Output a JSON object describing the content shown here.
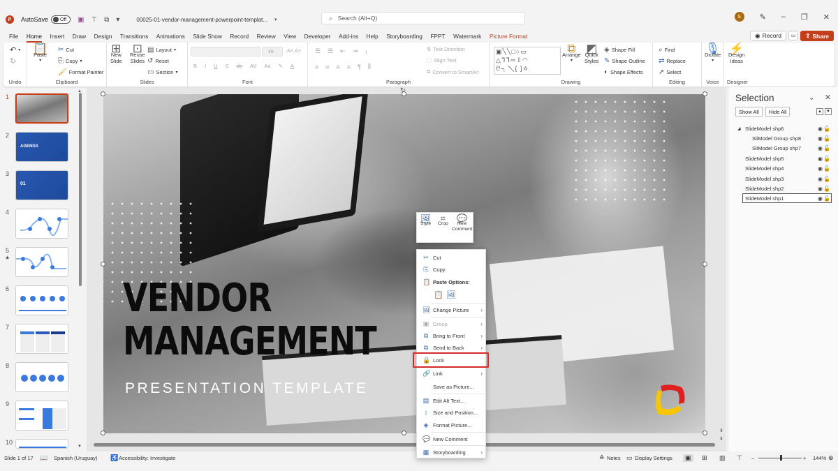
{
  "titlebar": {
    "app_icon": "P",
    "autosave_label": "AutoSave",
    "autosave_state": "Off",
    "document_title": "00025-01-vendor-management-powerpoint-templat...",
    "search_placeholder": "Search (Alt+Q)",
    "user_initial": "S"
  },
  "menu": {
    "tabs": [
      "File",
      "Home",
      "Insert",
      "Draw",
      "Design",
      "Transitions",
      "Animations",
      "Slide Show",
      "Record",
      "Review",
      "View",
      "Developer",
      "Add-ins",
      "Help",
      "Storyboarding",
      "FPPT",
      "Watermark",
      "Picture Format"
    ],
    "active": "Home",
    "record_label": "Record",
    "share_label": "Share"
  },
  "ribbon": {
    "undo_group": "Undo",
    "clipboard": {
      "label": "Clipboard",
      "paste": "Paste",
      "cut": "Cut",
      "copy": "Copy",
      "format_painter": "Format Painter"
    },
    "slides": {
      "label": "Slides",
      "new_slide": "New",
      "new_slide2": "Slide",
      "reuse": "Reuse",
      "reuse2": "Slides",
      "layout": "Layout",
      "reset": "Reset",
      "section": "Section"
    },
    "font": {
      "label": "Font",
      "size": "48",
      "bold": "B",
      "italic": "I",
      "underline": "U",
      "strike": "S",
      "abc": "ab",
      "spacing": "AV",
      "case": "Aa"
    },
    "paragraph": {
      "label": "Paragraph",
      "text_direction": "Text Direction",
      "align_text": "Align Text",
      "smartart": "Convert to SmartArt"
    },
    "drawing": {
      "label": "Drawing",
      "arrange": "Arrange",
      "quick_styles": "Quick",
      "quick_styles2": "Styles",
      "shape_fill": "Shape Fill",
      "shape_outline": "Shape Outline",
      "shape_effects": "Shape Effects"
    },
    "editing": {
      "label": "Editing",
      "find": "Find",
      "replace": "Replace",
      "select": "Select"
    },
    "voice": {
      "label": "Voice",
      "dictate": "Dictate"
    },
    "designer": {
      "label": "Designer",
      "design_ideas": "Design",
      "design_ideas2": "Ideas"
    }
  },
  "thumbnails": [
    "1",
    "2",
    "3",
    "4",
    "5",
    "6",
    "7",
    "8",
    "9",
    "10"
  ],
  "thumb_text": {
    "agenda": "AGENDA",
    "section": "01"
  },
  "slide": {
    "title_line1": "VENDOR",
    "title_line2": "MANAGEMENT",
    "subtitle": "PRESENTATION TEMPLATE"
  },
  "mini_toolbar": {
    "style": "Style",
    "crop": "Crop",
    "new_comment1": "New",
    "new_comment2": "Comment"
  },
  "context_menu": [
    {
      "label": "Cut",
      "icon": "✂"
    },
    {
      "label": "Copy",
      "icon": "⎘"
    },
    {
      "label": "Paste Options:",
      "icon": "📋"
    },
    {
      "label": "Change Picture",
      "icon": "🖼"
    },
    {
      "label": "Group",
      "icon": "▣"
    },
    {
      "label": "Bring to Front",
      "icon": "⧉"
    },
    {
      "label": "Send to Back",
      "icon": "⧉"
    },
    {
      "label": "Lock",
      "icon": "🔒"
    },
    {
      "label": "Link",
      "icon": "🔗"
    },
    {
      "label": "Save as Picture...",
      "icon": ""
    },
    {
      "label": "Edit Alt Text...",
      "icon": "▤"
    },
    {
      "label": "Size and Position...",
      "icon": "↕"
    },
    {
      "label": "Format Picture...",
      "icon": "◈"
    },
    {
      "label": "New Comment",
      "icon": "💬"
    },
    {
      "label": "Storyboarding",
      "icon": "▦"
    }
  ],
  "selection_pane": {
    "title": "Selection",
    "show_all": "Show All",
    "hide_all": "Hide All",
    "items": [
      "SlideModel shp6",
      "SliModel Group shp8",
      "SliModel Group shp7",
      "SlideModel shp5",
      "SlideModel shp4",
      "SlideModel shp3",
      "SlideModel shp2",
      "SlideModel shp1"
    ],
    "selected": "SlideModel shp1"
  },
  "status": {
    "slide_info": "Slide 1 of 17",
    "language": "Spanish (Uruguay)",
    "accessibility": "Accessibility: Investigate",
    "notes": "Notes",
    "display_settings": "Display Settings",
    "zoom_level": "144%"
  },
  "colors": {
    "accent": "#c43e1c",
    "lock_highlight": "#d42a2a",
    "logo_red": "#e02020",
    "logo_yellow": "#f7c600"
  }
}
